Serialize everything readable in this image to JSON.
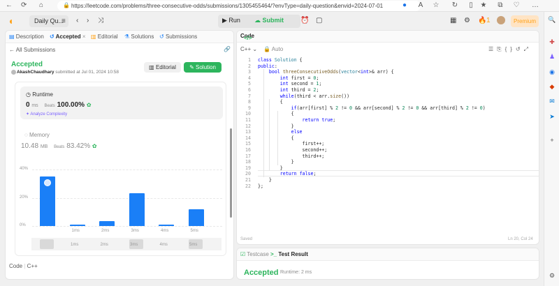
{
  "browser": {
    "url": "https://leetcode.com/problems/three-consecutive-odds/submissions/1305455464/?envType=daily-question&envid=2024-07-01",
    "lock_icon": "lock-icon"
  },
  "topbar": {
    "daily_label": "Daily Qu...",
    "run_label": "Run",
    "submit_label": "Submit",
    "streak_count": "1",
    "premium_label": "Premium"
  },
  "left": {
    "tabs": [
      {
        "label": "Description"
      },
      {
        "label": "Accepted"
      },
      {
        "label": "Editorial"
      },
      {
        "label": "Solutions"
      },
      {
        "label": "Submissions"
      }
    ],
    "tab_close": "×",
    "all_submissions": "All Submissions",
    "status": "Accepted",
    "user": "AkashChaudhary",
    "submitted_text": "submitted at Jul 01, 2024 10:58",
    "editorial_btn": "Editorial",
    "solution_btn": "Solution",
    "runtime": {
      "label": "Runtime",
      "value": "0",
      "unit": "ms",
      "beats_label": "Beats",
      "beats_pct": "100.00%",
      "analyze": "Analyze Complexity"
    },
    "memory": {
      "label": "Memory",
      "value": "10.48",
      "unit": "MB",
      "beats_label": "Beats",
      "beats_pct": "83.42%"
    },
    "code_label": "Code",
    "code_lang": "C++"
  },
  "chart_data": {
    "type": "bar",
    "ytick_labels": [
      "40%",
      "20%",
      "0%"
    ],
    "ylim": [
      0,
      40
    ],
    "categories": [
      "0ms",
      "1ms",
      "2ms",
      "3ms",
      "4ms",
      "5ms"
    ],
    "xtick_labels": [
      "1ms",
      "2ms",
      "3ms",
      "4ms",
      "5ms"
    ],
    "values": [
      35,
      1,
      3.5,
      23,
      1,
      12
    ],
    "highlighted_index": 0,
    "color": "#1a7ff7",
    "strip_labels": [
      "1ms",
      "2ms",
      "3ms",
      "4ms",
      "5ms"
    ]
  },
  "editor": {
    "title": "Code",
    "lang": "C++",
    "auto": "Auto",
    "lines": [
      "class Solution {",
      "public:",
      "    bool threeConsecutiveOdds(vector<int>& arr) {",
      "        int first = 0;",
      "        int second = 1;",
      "        int third = 2;",
      "        while(third < arr.size())",
      "        {",
      "            if(arr[first] % 2 != 0 && arr[second] % 2 != 0 && arr[third] % 2 != 0)",
      "            {",
      "                return true;",
      "            }",
      "            else",
      "            {",
      "                first++;",
      "                second++;",
      "                third++;",
      "            }",
      "        }",
      "        return false;",
      "    }",
      "};"
    ],
    "saved": "Saved",
    "position": "Ln 20, Col 24"
  },
  "bottom": {
    "testcase_tab": "Testcase",
    "result_tab": "Test Result",
    "status": "Accepted",
    "runtime": "Runtime: 2 ms"
  }
}
